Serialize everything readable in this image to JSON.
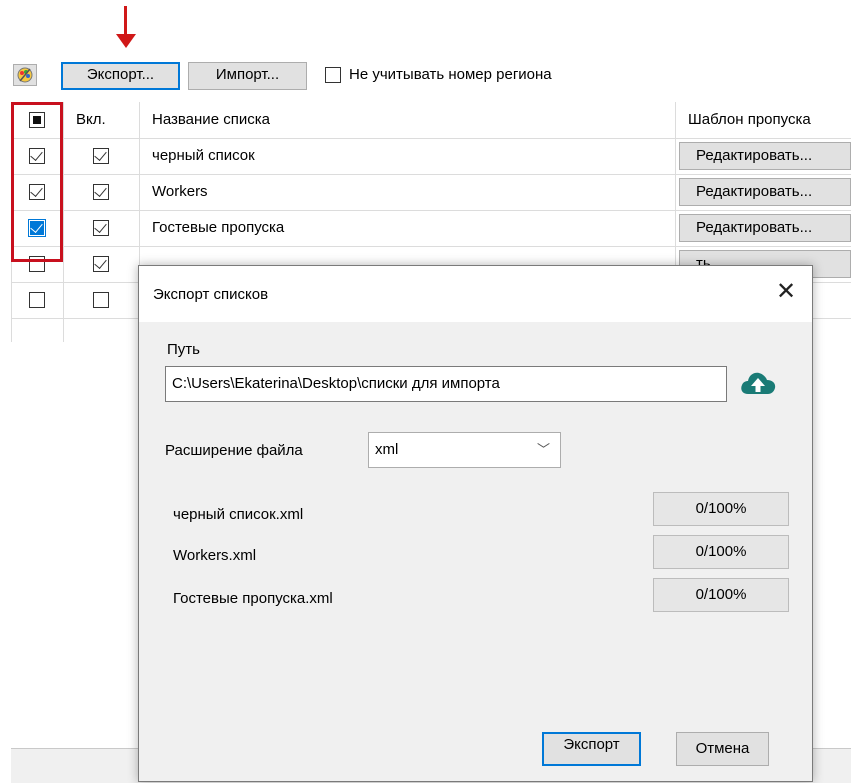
{
  "toolbar": {
    "export_label": "Экспорт...",
    "import_label": "Импорт...",
    "ignore_region_label": "Не учитывать номер региона",
    "ignore_region_checked": false
  },
  "grid": {
    "headers": {
      "enabled": "Вкл.",
      "name": "Название списка",
      "template": "Шаблон пропуска"
    },
    "rows": [
      {
        "selected": true,
        "enabled": true,
        "name": "черный список",
        "template_button": "Редактировать..."
      },
      {
        "selected": true,
        "enabled": true,
        "name": "Workers",
        "template_button": "Редактировать..."
      },
      {
        "selected": true,
        "enabled": true,
        "name": "Гостевые пропуска",
        "template_button": "Редактировать..."
      },
      {
        "selected": false,
        "enabled": true,
        "name": "",
        "template_button": "ть..."
      },
      {
        "selected": false,
        "enabled": false,
        "name": "",
        "template_button": ""
      }
    ]
  },
  "dialog": {
    "title": "Экспорт списков",
    "path_label": "Путь",
    "path_value": "C:\\Users\\Ekaterina\\Desktop\\списки для импорта",
    "extension_label": "Расширение файла",
    "extension_value": "xml",
    "files": [
      {
        "name": "черный список.xml",
        "progress": "0/100%",
        "fraction": 0
      },
      {
        "name": "Workers.xml",
        "progress": "0/100%",
        "fraction": 0
      },
      {
        "name": "Гостевые пропуска.xml",
        "progress": "0/100%",
        "fraction": 0
      }
    ],
    "export_button": "Экспорт",
    "cancel_button": "Отмена"
  },
  "colors": {
    "accent": "#0078d7",
    "annotation": "#c8101e",
    "upload_icon": "#1a7b76"
  }
}
